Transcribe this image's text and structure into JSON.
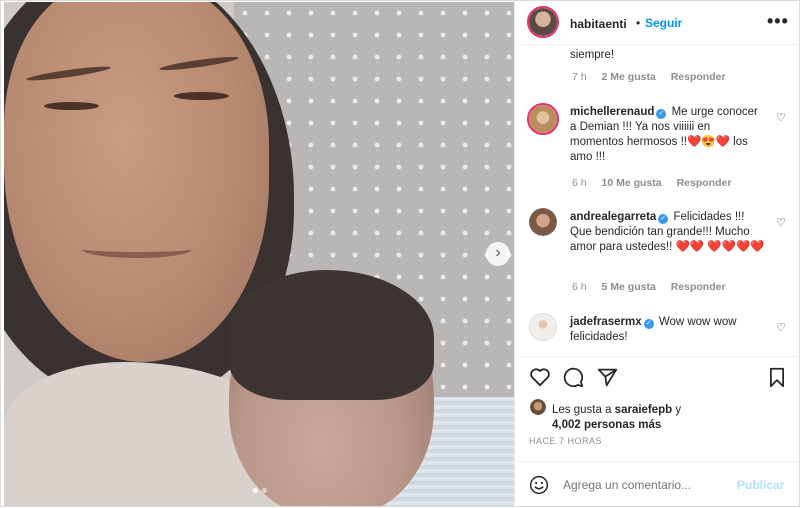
{
  "post": {
    "username": "habitaenti",
    "follow_label": "Seguir",
    "separator": "•"
  },
  "comments": [
    {
      "text": "siempre!",
      "time": "7 h",
      "likes": "2 Me gusta",
      "reply": "Responder"
    },
    {
      "user": "michellerenaud",
      "text": "Me urge conocer a Demian !!! Ya nos viiiiii en momentos hermosos !!",
      "emoji": "❤️😍❤️",
      "text2": "los amo !!!",
      "time": "6 h",
      "likes": "10 Me gusta",
      "reply": "Responder"
    },
    {
      "user": "andrealegarreta",
      "text": "Felicidades !!! Que bendición tan grande!!! Mucho amor para ustedes!!",
      "emoji": "❤️❤️",
      "emoji2": "❤️❤️❤️❤️",
      "time": "6 h",
      "likes": "5 Me gusta",
      "reply": "Responder"
    },
    {
      "user": "jadefrasermx",
      "text": "Wow wow wow felicidades!"
    }
  ],
  "likes": {
    "prefix": "Les gusta a",
    "user": "saraiefepb",
    "joiner": "y",
    "count": "4,002 personas más"
  },
  "timestamp": "HACE 7 HORAS",
  "add_comment": {
    "placeholder": "Agrega un comentario...",
    "post_label": "Publicar"
  },
  "icons": {
    "verified": "✓",
    "more": "•••",
    "next": "›"
  },
  "colors": {
    "accent": "#0095f6",
    "verified": "#3897f0",
    "heart": "#ed4956"
  }
}
